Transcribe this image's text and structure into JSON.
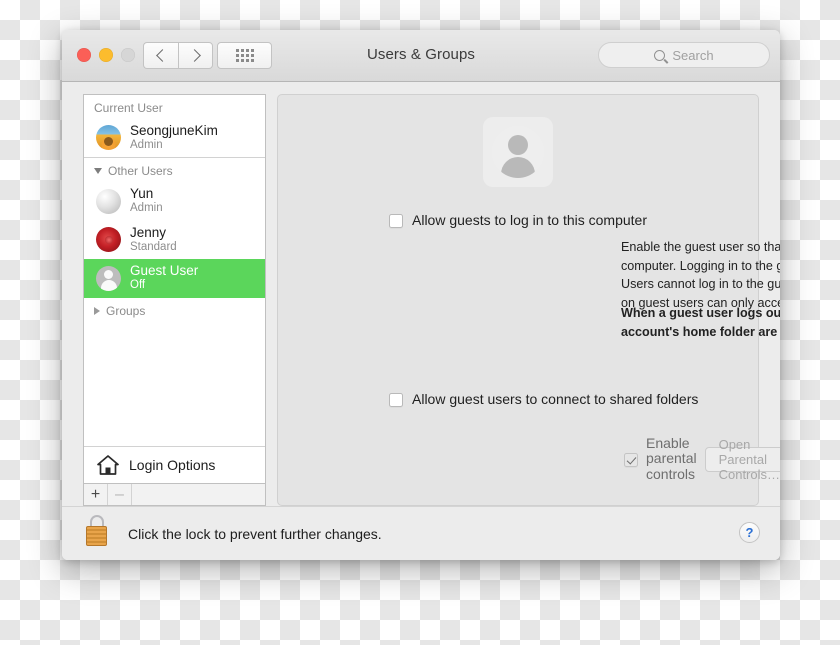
{
  "window": {
    "title": "Users & Groups",
    "traffic_lights": [
      "close",
      "minimize",
      "zoom"
    ]
  },
  "toolbar": {
    "back_icon": "chevron-left-icon",
    "forward_icon": "chevron-right-icon",
    "show_all_icon": "grid-icon",
    "search": {
      "icon": "search-icon",
      "placeholder": "Search",
      "value": ""
    }
  },
  "sidebar": {
    "current_user_header": "Current User",
    "other_users_header": "Other Users",
    "groups_header": "Groups",
    "users": [
      {
        "name": "SeongjuneKim",
        "role": "Admin",
        "avatar": "sunflower-photo",
        "selected": false
      },
      {
        "name": "Yun",
        "role": "Admin",
        "avatar": "gray-sphere-photo",
        "selected": false
      },
      {
        "name": "Jenny",
        "role": "Standard",
        "avatar": "red-rose-photo",
        "selected": false
      },
      {
        "name": "Guest User",
        "role": "Off",
        "avatar": "default-person",
        "selected": true
      }
    ],
    "login_options": "Login Options",
    "login_options_icon": "house-icon",
    "add_button": "+",
    "remove_button": "–",
    "selection_color": "#5bd65b"
  },
  "main": {
    "avatar_icon": "guest-user-avatar",
    "allow_guests_label": "Allow guests to log in to this computer",
    "allow_guests_checked": false,
    "description": "Enable the guest user so that friends can temporarily log in to your computer. Logging in to the guest account does not require a password. Users cannot log in to the guest account remotely. If FileVault is turned on guest users can only access Safari.",
    "warning": "When a guest user logs out, all information and files in the guest account's home folder are deleted.",
    "parental_controls_label": "Enable parental controls",
    "parental_controls_checked": true,
    "parental_controls_button": "Open Parental Controls…",
    "shared_folders_label": "Allow guest users to connect to shared folders",
    "shared_folders_checked": false
  },
  "footer": {
    "lock_icon": "unlocked-padlock-icon",
    "lock_text": "Click the lock to prevent further changes.",
    "help_label": "?"
  }
}
